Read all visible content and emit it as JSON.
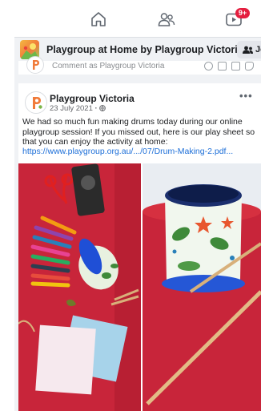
{
  "topnav": {
    "items": [
      {
        "icon": "home-icon"
      },
      {
        "icon": "groups-icon"
      },
      {
        "icon": "video-icon",
        "badge": "9+"
      }
    ]
  },
  "group_bar": {
    "title": "Playgroup at Home by Playgroup Victoria",
    "join_label": "Jo"
  },
  "comment_box": {
    "placeholder": "Comment as Playgroup Victoria",
    "icons": [
      "emoji-icon",
      "camera-icon",
      "gif-icon",
      "sticker-icon"
    ]
  },
  "post": {
    "author": "Playgroup Victoria",
    "date": "23 July 2021",
    "privacy_icon": "globe-icon",
    "text": "We had so much fun making drums today during our online playgroup session! If you missed out, here is our play sheet so that you can enjoy the activity at home:",
    "link": "https://www.playgroup.org.au/.../07/Drum-Making-2.pdf...",
    "photos": [
      {
        "description_icon": "craft-supplies-photo"
      },
      {
        "description_icon": "decorated-drum-photo"
      }
    ]
  },
  "colors": {
    "brand_blue": "#1d6fd8",
    "badge_red": "#e41e3f",
    "background": "#f0f2f5"
  }
}
